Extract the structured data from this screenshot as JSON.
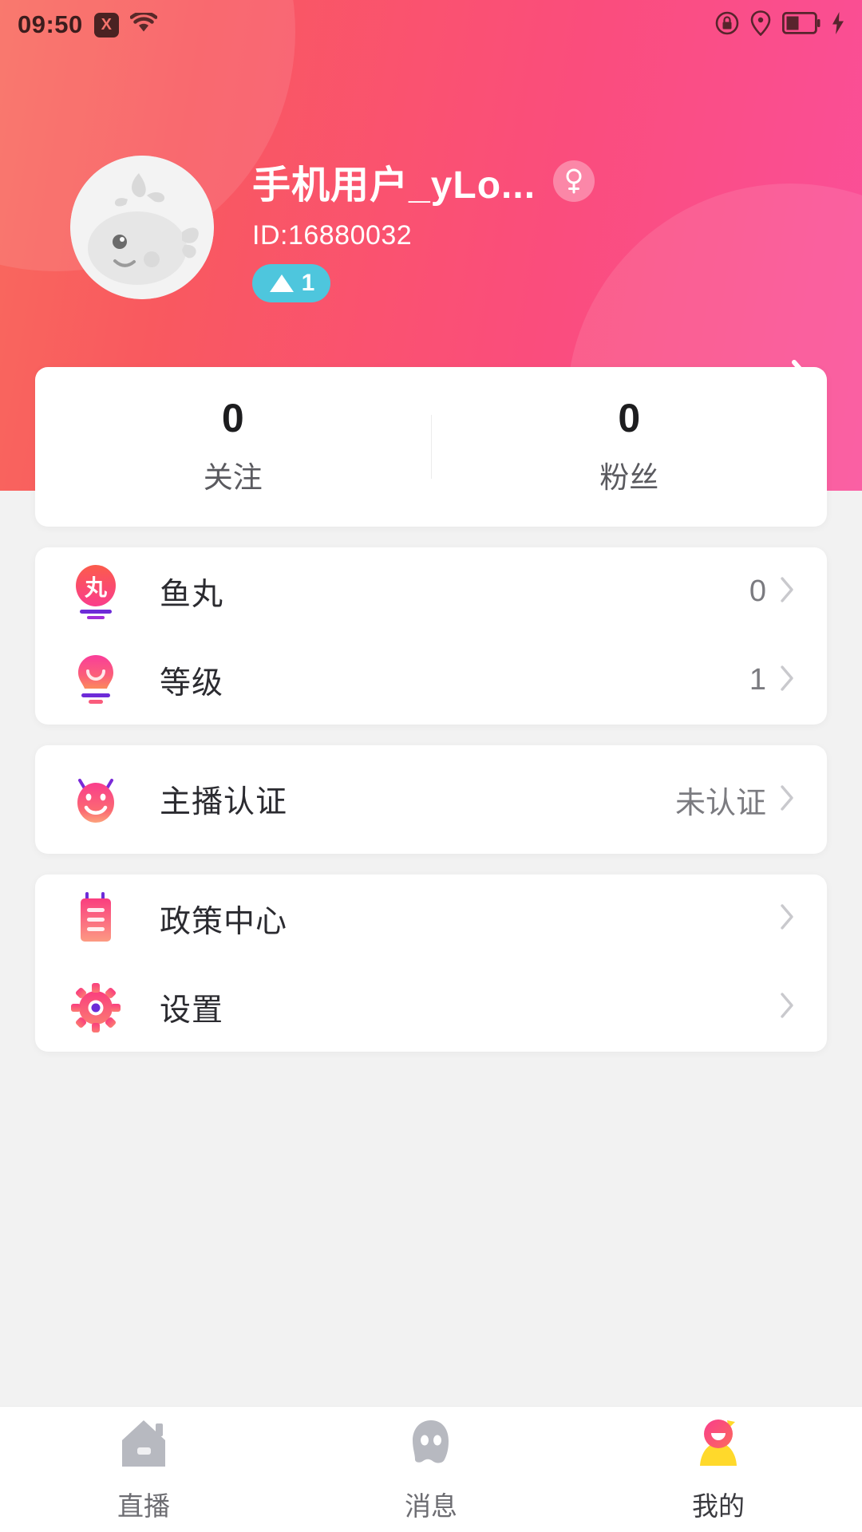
{
  "status_bar": {
    "time": "09:50",
    "x_badge": "X",
    "icons": [
      "wifi-icon",
      "lock-icon",
      "location-icon",
      "battery-icon",
      "charging-bolt-icon"
    ]
  },
  "header": {
    "username": "手机用户_yLo...",
    "user_id": "ID:16880032",
    "gender": "female",
    "level": "1",
    "avatar": "whale-avatar",
    "arrow": "chevron-right-icon",
    "gradient_start": "#f96a5e",
    "gradient_end": "#fa4f9a"
  },
  "stats": [
    {
      "value": "0",
      "label": "关注"
    },
    {
      "value": "0",
      "label": "粉丝"
    }
  ],
  "menu_groups": [
    {
      "rows": [
        {
          "icon": "fishball-icon",
          "label": "鱼丸",
          "value": "0",
          "chevron": true
        },
        {
          "icon": "lightbulb-icon",
          "label": "等级",
          "value": "1",
          "chevron": true
        }
      ]
    },
    {
      "rows": [
        {
          "icon": "devil-face-icon",
          "label": "主播认证",
          "value": "未认证",
          "chevron": true
        }
      ]
    },
    {
      "rows": [
        {
          "icon": "notepad-icon",
          "label": "政策中心",
          "value": "",
          "chevron": true
        },
        {
          "icon": "gear-icon",
          "label": "设置",
          "value": "",
          "chevron": true
        }
      ]
    }
  ],
  "bottom_nav": [
    {
      "icon": "house-icon",
      "label": "直播",
      "active": false
    },
    {
      "icon": "ghost-message-icon",
      "label": "消息",
      "active": false
    },
    {
      "icon": "person-icon",
      "label": "我的",
      "active": true
    }
  ],
  "colors": {
    "accent_pink": "#fa4f9a",
    "accent_red": "#f96a5e",
    "level_badge": "#4ec6dd",
    "nav_inactive": "#b7b9c0",
    "nav_active_body": "#ffd92b"
  }
}
